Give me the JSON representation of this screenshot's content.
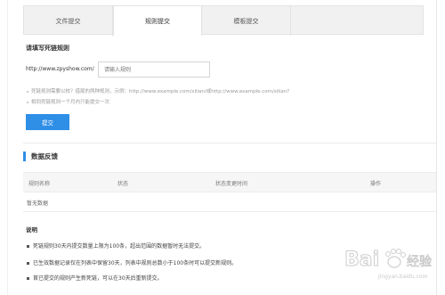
{
  "tabs": [
    {
      "label": "文件提交",
      "active": false
    },
    {
      "label": "规则提交",
      "active": true
    },
    {
      "label": "模板提交",
      "active": false
    }
  ],
  "form": {
    "section_title": "请填写死链规则",
    "url_prefix": "http://www.zpyshow.com/",
    "input_placeholder": "请输入规则",
    "tips": [
      "死链规则需要以校？借尾的两种规则，示例：http://www.example.com/silian/或http://www.example.com/silian?",
      "相同死链规则一个月内只能提交一次"
    ],
    "submit_label": "提交"
  },
  "feedback": {
    "title": "数据反馈",
    "columns": [
      "规则名称",
      "状态",
      "状态变更时间",
      "操作"
    ],
    "empty_text": "暂无数据"
  },
  "notes": {
    "title": "说明",
    "items": [
      "死链规则30天内提交数量上限为100条，超出范围的数据暂时无法提交。",
      "已生效数据记录仅在列表中保留30天，列表中规则总数小于100条时可以提交新规则。",
      "首已提交的规则产生新死链，可以在30天后重新提交。"
    ]
  },
  "watermark": {
    "text": "Baidu 经验",
    "subtext": "jingyan.baidu.com"
  },
  "colors": {
    "accent": "#2f8ee6",
    "tab_bg": "#f1f1f1"
  }
}
